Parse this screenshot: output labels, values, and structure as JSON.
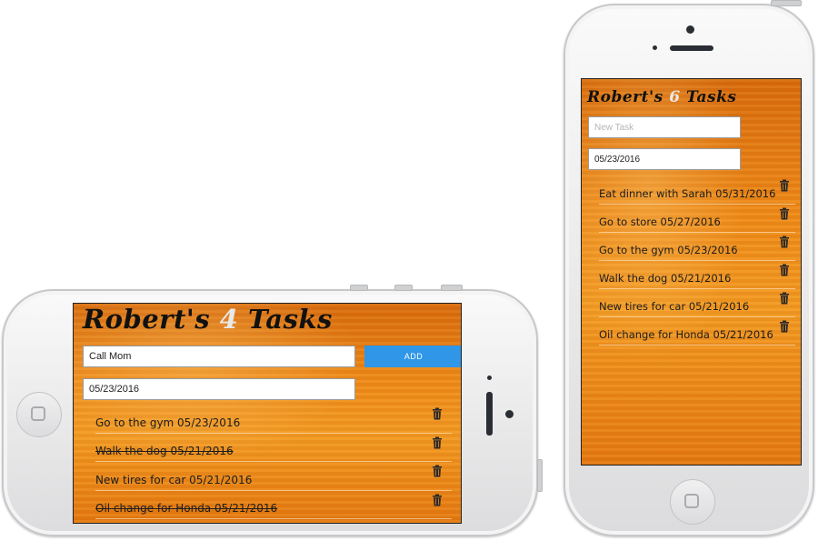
{
  "landscape": {
    "title_prefix": "Robert's",
    "count": "4",
    "title_suffix": "Tasks",
    "task_input_value": "Call Mom",
    "add_label": "ADD",
    "date_value": "05/23/2016",
    "tasks": [
      {
        "text": "Go to the gym 05/23/2016",
        "completed": false
      },
      {
        "text": "Walk the dog 05/21/2016",
        "completed": true
      },
      {
        "text": "New tires for car 05/21/2016",
        "completed": false
      },
      {
        "text": "Oil change for Honda 05/21/2016",
        "completed": true
      }
    ]
  },
  "portrait": {
    "title_prefix": "Robert's",
    "count": "6",
    "title_suffix": "Tasks",
    "task_input_placeholder": "New Task",
    "date_value": "05/23/2016",
    "tasks": [
      {
        "text": "Eat dinner with Sarah 05/31/2016",
        "completed": false
      },
      {
        "text": "Go to store 05/27/2016",
        "completed": false
      },
      {
        "text": "Go to the gym 05/23/2016",
        "completed": false
      },
      {
        "text": "Walk the dog 05/21/2016",
        "completed": false
      },
      {
        "text": "New tires for car 05/21/2016",
        "completed": false
      },
      {
        "text": "Oil change for Honda 05/21/2016",
        "completed": false
      }
    ]
  },
  "icons": {
    "delete": "trash-icon",
    "home": "home-button-icon"
  },
  "colors": {
    "background_orange": "#ee8a18",
    "add_button": "#2f96e8",
    "count_digit": "#e9e9e9",
    "phone_body": "#ececed"
  }
}
